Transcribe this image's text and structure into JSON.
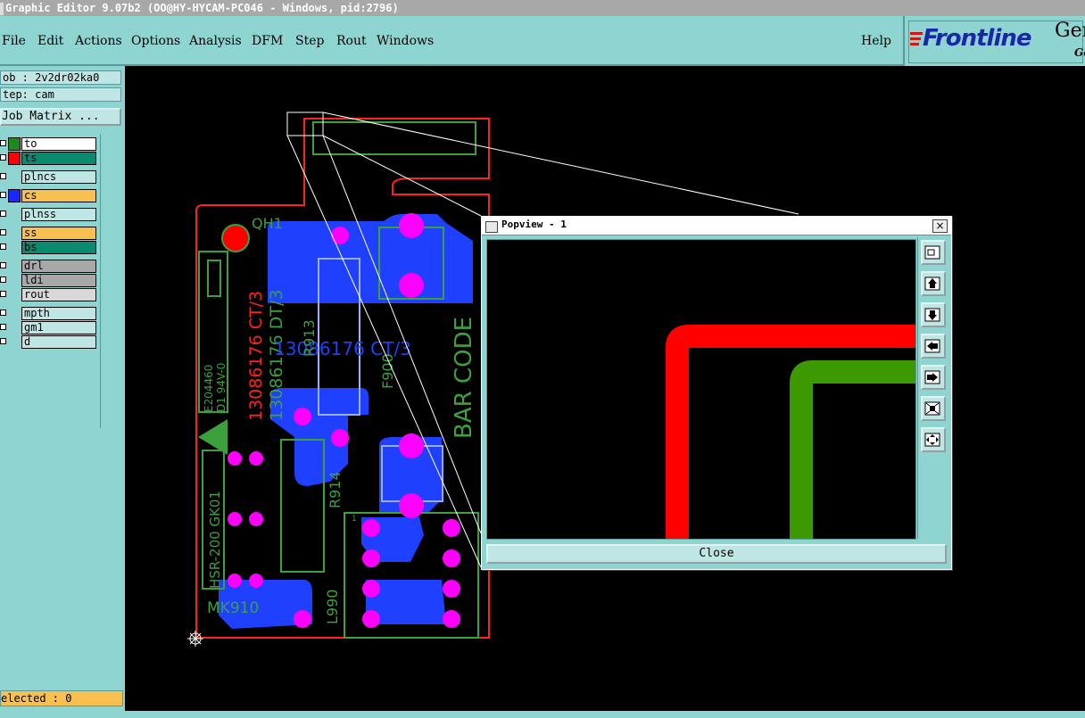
{
  "window": {
    "title": "Graphic Editor 9.07b2 (OO@HY-HYCAM-PC046 - Windows, pid:2796)"
  },
  "menu": {
    "items": [
      "File",
      "Edit",
      "Actions",
      "Options",
      "Analysis",
      "DFM",
      "Step",
      "Rout",
      "Windows"
    ],
    "help": "Help"
  },
  "logo": {
    "brand": "Frontline",
    "gen": "Ger",
    "gen2": "Ge"
  },
  "left_panel": {
    "job": "ob : 2v2dr02ka0",
    "step": "tep: cam",
    "job_matrix": "Job Matrix ...",
    "layers": [
      {
        "name": "to",
        "color": "#1e8a1e",
        "bg": "#ffffff"
      },
      {
        "name": "ts",
        "color": "#ff0000",
        "bg": "#0a8a6e"
      },
      {
        "name": "plncs",
        "color": "#8ed4d0",
        "bg": "#bfe6e4"
      },
      {
        "name": "cs",
        "color": "#1a28ff",
        "bg": "#f8c050"
      },
      {
        "name": "plnss",
        "color": "#8ed4d0",
        "bg": "#bfe6e4"
      },
      {
        "name": "ss",
        "color": "#8ed4d0",
        "bg": "#f8c050"
      },
      {
        "name": "bs",
        "color": "#8ed4d0",
        "bg": "#0a8a6e"
      },
      {
        "name": "drl",
        "color": "#8ed4d0",
        "bg": "#a8a8a8"
      },
      {
        "name": "ldi",
        "color": "#8ed4d0",
        "bg": "#a8a8a8"
      },
      {
        "name": "rout",
        "color": "#8ed4d0",
        "bg": "#d8d8d8"
      },
      {
        "name": "mpth",
        "color": "#8ed4d0",
        "bg": "#bfe6e4"
      },
      {
        "name": "gm1",
        "color": "#8ed4d0",
        "bg": "#bfe6e4"
      },
      {
        "name": "d",
        "color": "#8ed4d0",
        "bg": "#bfe6e4"
      }
    ],
    "selected": "elected : 0"
  },
  "board": {
    "labels": {
      "qh1": "QH1",
      "ct3": "13086176 CT/3",
      "dt3": "13086176 DT/3",
      "ct3_blue": "13086176 CT/3",
      "r913": "R913",
      "f900": "F900",
      "barcode": "BAR CODE",
      "e204460": "E204460",
      "d1": "D1 94V-0",
      "r914": "R914",
      "hsr": "HSR-200 GK01",
      "mk910": "MK910",
      "l990": "L990",
      "one": "1"
    },
    "colors": {
      "outline": "#ff2020",
      "silk": "#3ca03c",
      "copper": "#1f40ff",
      "pad": "#ff00ff",
      "red_text": "#ff2020"
    }
  },
  "popview": {
    "title": "Popview - 1",
    "close_x": "×",
    "close_button": "Close",
    "tools": [
      "zoom-fit-icon",
      "pan-up-icon",
      "pan-down-icon",
      "pan-left-icon",
      "pan-right-icon",
      "zoom-out-icon",
      "zoom-in-icon"
    ],
    "colors": {
      "red_trace": "#ff0000",
      "green_trace": "#3c9a00"
    }
  }
}
